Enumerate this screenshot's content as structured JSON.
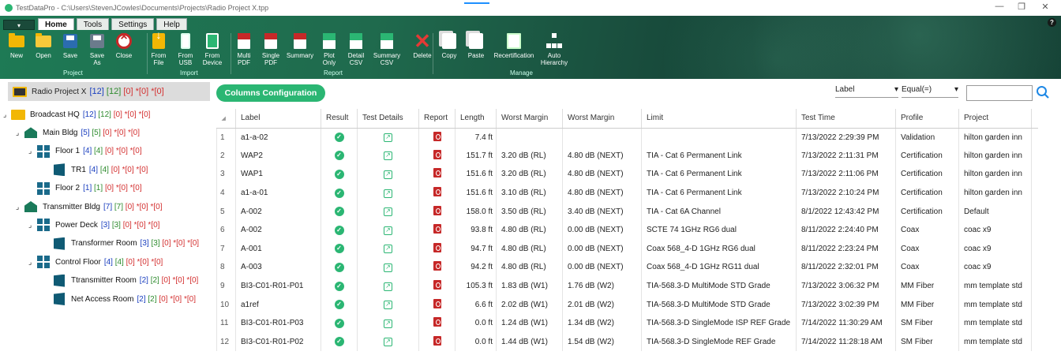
{
  "window": {
    "title": "TestDataPro - C:\\Users\\StevenJCowles\\Documents\\Projects\\Radio Project X.tpp",
    "minimize": "—",
    "maximize": "❐",
    "close": "✕"
  },
  "ribbon": {
    "tabs": [
      "Home",
      "Tools",
      "Settings",
      "Help"
    ],
    "help_icon": "?",
    "groups": [
      "Project",
      "Import",
      "Report",
      "Manage"
    ],
    "buttons": [
      {
        "id": "new",
        "label": "New",
        "icon": "folder-icon"
      },
      {
        "id": "open",
        "label": "Open",
        "icon": "folder-open-icon"
      },
      {
        "id": "save",
        "label": "Save",
        "icon": "save-icon"
      },
      {
        "id": "save-as",
        "label": "Save\nAs",
        "icon": "save-as-icon"
      },
      {
        "id": "close",
        "label": "Close",
        "icon": "close-icon"
      },
      {
        "id": "from-file",
        "label": "From\nFile",
        "icon": "file-import-icon"
      },
      {
        "id": "from-usb",
        "label": "From\nUSB",
        "icon": "usb-icon"
      },
      {
        "id": "from-device",
        "label": "From\nDevice",
        "icon": "device-icon"
      },
      {
        "id": "multi-pdf",
        "label": "Multi\nPDF",
        "icon": "pdf-icon"
      },
      {
        "id": "single-pdf",
        "label": "Single\nPDF",
        "icon": "pdf-icon"
      },
      {
        "id": "summary",
        "label": "Summary",
        "icon": "pdf-icon"
      },
      {
        "id": "plot-only",
        "label": "Plot\nOnly",
        "icon": "csv-icon"
      },
      {
        "id": "detail-csv",
        "label": "Detail\nCSV",
        "icon": "csv-icon"
      },
      {
        "id": "summary-csv",
        "label": "Summary\nCSV",
        "icon": "csv-icon"
      },
      {
        "id": "delete",
        "label": "Delete",
        "icon": "delete-icon"
      },
      {
        "id": "copy",
        "label": "Copy",
        "icon": "copy-icon"
      },
      {
        "id": "paste",
        "label": "Paste",
        "icon": "paste-icon"
      },
      {
        "id": "recertification",
        "label": "Recertification",
        "icon": "recertification-icon"
      },
      {
        "id": "auto-hierarchy",
        "label": "Auto\nHierarchy",
        "icon": "hierarchy-icon"
      }
    ]
  },
  "tree": {
    "root": {
      "name": "Radio Project X",
      "c1": "[12]",
      "c2": "[12]",
      "c3": "[0]",
      "c4": "*[0]",
      "c5": "*[0]"
    },
    "nodes": [
      {
        "name": "Broadcast HQ",
        "c1": "[12]",
        "c2": "[12]",
        "c3": "[0]",
        "c4": "*[0]",
        "c5": "*[0]",
        "type": "folder",
        "expander": "⌟"
      },
      {
        "name": "Main Bldg",
        "c1": "[5]",
        "c2": "[5]",
        "c3": "[0]",
        "c4": "*[0]",
        "c5": "*[0]",
        "type": "building",
        "expander": "⌟"
      },
      {
        "name": "Floor 1",
        "c1": "[4]",
        "c2": "[4]",
        "c3": "[0]",
        "c4": "*[0]",
        "c5": "*[0]",
        "type": "floor",
        "expander": "⌟"
      },
      {
        "name": "TR1",
        "c1": "[4]",
        "c2": "[4]",
        "c3": "[0]",
        "c4": "*[0]",
        "c5": "*[0]",
        "type": "room",
        "expander": ""
      },
      {
        "name": "Floor 2",
        "c1": "[1]",
        "c2": "[1]",
        "c3": "[0]",
        "c4": "*[0]",
        "c5": "*[0]",
        "type": "floor",
        "expander": ""
      },
      {
        "name": "Transmitter Bldg",
        "c1": "[7]",
        "c2": "[7]",
        "c3": "[0]",
        "c4": "*[0]",
        "c5": "*[0]",
        "type": "building",
        "expander": "⌟"
      },
      {
        "name": "Power Deck",
        "c1": "[3]",
        "c2": "[3]",
        "c3": "[0]",
        "c4": "*[0]",
        "c5": "*[0]",
        "type": "floor",
        "expander": "⌟"
      },
      {
        "name": "Transformer Room",
        "c1": "[3]",
        "c2": "[3]",
        "c3": "[0]",
        "c4": "*[0]",
        "c5": "*[0]",
        "type": "room",
        "expander": ""
      },
      {
        "name": "Control Floor",
        "c1": "[4]",
        "c2": "[4]",
        "c3": "[0]",
        "c4": "*[0]",
        "c5": "*[0]",
        "type": "floor",
        "expander": "⌟"
      },
      {
        "name": "Ttransmitter Room",
        "c1": "[2]",
        "c2": "[2]",
        "c3": "[0]",
        "c4": "*[0]",
        "c5": "*[0]",
        "type": "room",
        "expander": ""
      },
      {
        "name": "Net Access Room",
        "c1": "[2]",
        "c2": "[2]",
        "c3": "[0]",
        "c4": "*[0]",
        "c5": "*[0]",
        "type": "room",
        "expander": ""
      }
    ]
  },
  "main": {
    "columns_config_label": "Columns Configuration",
    "filter": {
      "field": "Label",
      "operator": "Equal(=)",
      "value": ""
    },
    "columns": [
      "Label",
      "Result",
      "Test Details",
      "Report",
      "Length",
      "Worst Margin",
      "Worst Margin",
      "Limit",
      "Test Time",
      "Profile",
      "Project"
    ],
    "rows": [
      {
        "n": "1",
        "label": "a1-a-02",
        "length": "7.4 ft",
        "wm1": "",
        "wm2": "",
        "limit": "",
        "time": "7/13/2022 2:29:39 PM",
        "profile": "Validation",
        "project": "hilton garden inn"
      },
      {
        "n": "2",
        "label": "WAP2",
        "length": "151.7 ft",
        "wm1": "3.20 dB (RL)",
        "wm2": "4.80 dB (NEXT)",
        "limit": "TIA - Cat 6 Permanent Link",
        "time": "7/13/2022 2:11:31 PM",
        "profile": "Certification",
        "project": "hilton garden inn"
      },
      {
        "n": "3",
        "label": "WAP1",
        "length": "151.6 ft",
        "wm1": "3.20 dB (RL)",
        "wm2": "4.80 dB (NEXT)",
        "limit": "TIA - Cat 6 Permanent Link",
        "time": "7/13/2022 2:11:06 PM",
        "profile": "Certification",
        "project": "hilton garden inn"
      },
      {
        "n": "4",
        "label": "a1-a-01",
        "length": "151.6 ft",
        "wm1": "3.10 dB (RL)",
        "wm2": "4.80 dB (NEXT)",
        "limit": "TIA - Cat 6 Permanent Link",
        "time": "7/13/2022 2:10:24 PM",
        "profile": "Certification",
        "project": "hilton garden inn"
      },
      {
        "n": "5",
        "label": "A-002",
        "length": "158.0 ft",
        "wm1": "3.50 dB (RL)",
        "wm2": "3.40 dB (NEXT)",
        "limit": "TIA - Cat 6A Channel",
        "time": "8/1/2022 12:43:42 PM",
        "profile": "Certification",
        "project": "Default"
      },
      {
        "n": "6",
        "label": "A-002",
        "length": "93.8 ft",
        "wm1": "4.80 dB (RL)",
        "wm2": "0.00 dB (NEXT)",
        "limit": "SCTE 74 1GHz RG6 dual",
        "time": "8/11/2022 2:24:40 PM",
        "profile": "Coax",
        "project": "coac x9"
      },
      {
        "n": "7",
        "label": "A-001",
        "length": "94.7 ft",
        "wm1": "4.80 dB (RL)",
        "wm2": "0.00 dB (NEXT)",
        "limit": "Coax 568_4-D 1GHz RG6 dual",
        "time": "8/11/2022 2:23:24 PM",
        "profile": "Coax",
        "project": "coac x9"
      },
      {
        "n": "8",
        "label": "A-003",
        "length": "94.2 ft",
        "wm1": "4.80 dB (RL)",
        "wm2": "0.00 dB (NEXT)",
        "limit": "Coax 568_4-D 1GHz RG11 dual",
        "time": "8/11/2022 2:32:01 PM",
        "profile": "Coax",
        "project": "coac x9"
      },
      {
        "n": "9",
        "label": "BI3-C01-R01-P01",
        "length": "105.3 ft",
        "wm1": "1.83 dB (W1)",
        "wm2": "1.76 dB (W2)",
        "limit": "TIA-568.3-D MultiMode STD Grade",
        "time": "7/13/2022 3:06:32 PM",
        "profile": "MM Fiber",
        "project": "mm template std"
      },
      {
        "n": "10",
        "label": "a1ref",
        "length": "6.6 ft",
        "wm1": "2.02 dB (W1)",
        "wm2": "2.01 dB (W2)",
        "limit": "TIA-568.3-D MultiMode STD Grade",
        "time": "7/13/2022 3:02:39 PM",
        "profile": "MM Fiber",
        "project": "mm template std"
      },
      {
        "n": "11",
        "label": "BI3-C01-R01-P03",
        "length": "0.0 ft",
        "wm1": "1.24 dB (W1)",
        "wm2": "1.34 dB (W2)",
        "limit": "TIA-568.3-D SingleMode ISP REF Grade",
        "time": "7/14/2022 11:30:29 AM",
        "profile": "SM Fiber",
        "project": "mm template std"
      },
      {
        "n": "12",
        "label": "BI3-C01-R01-P02",
        "length": "0.0 ft",
        "wm1": "1.44 dB (W1)",
        "wm2": "1.54 dB (W2)",
        "limit": "TIA-568.3-D SingleMode REF Grade",
        "time": "7/14/2022 11:28:18 AM",
        "profile": "SM Fiber",
        "project": "mm template std"
      }
    ]
  }
}
